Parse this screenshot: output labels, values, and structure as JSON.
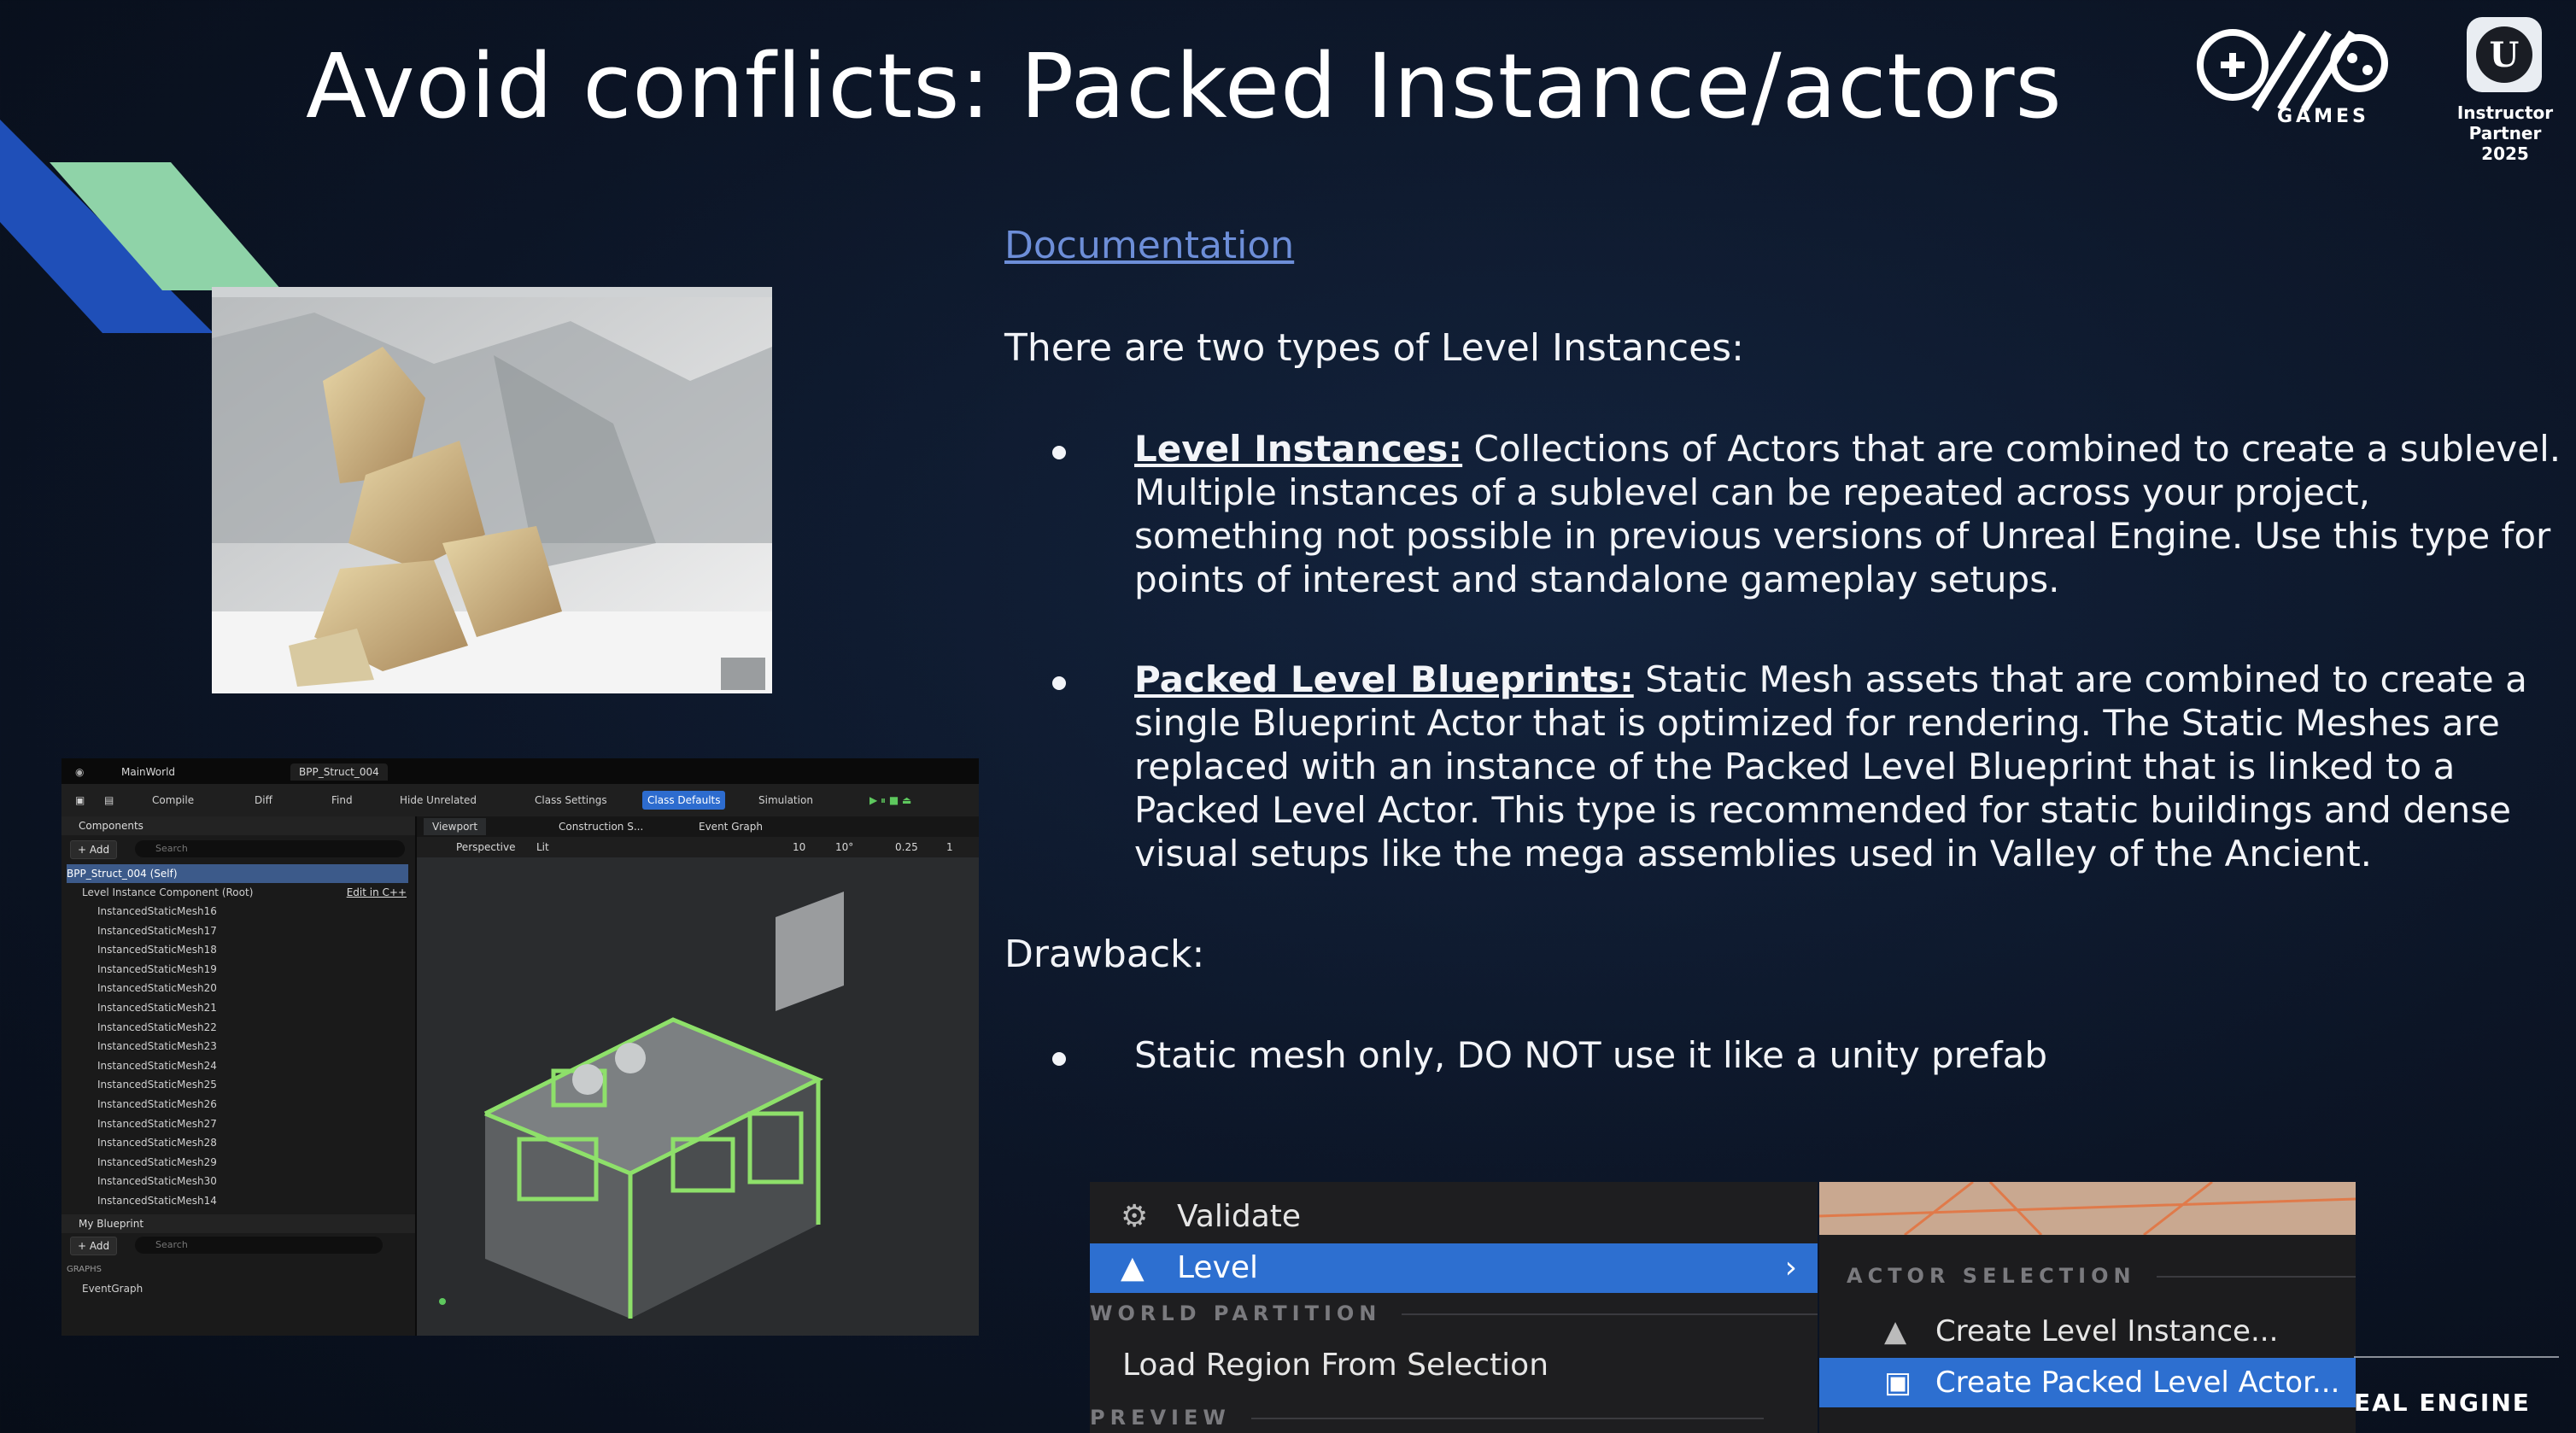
{
  "slide": {
    "title": "Avoid conflicts: Packed Instance/actors",
    "games_label": "GAMES",
    "partner": {
      "line1": "Instructor Partner",
      "line2": "2025"
    },
    "ue_badge_glyph": "U",
    "documentation_link": "Documentation",
    "intro": "There are two types of Level Instances:",
    "bullets": [
      {
        "term": "Level Instances:",
        "text": " Collections of Actors that are combined to create a sublevel.",
        "lines": [
          "Multiple instances of a sublevel can be repeated across your project,",
          "something not possible in previous versions of Unreal Engine. Use this type for",
          "points of interest and standalone gameplay setups."
        ]
      },
      {
        "term": "Packed Level Blueprints:",
        "text": " Static Mesh assets that are combined to create a",
        "lines": [
          "single Blueprint Actor that is optimized for rendering. The Static Meshes are",
          "replaced with an instance of the Packed Level Blueprint that is linked to a",
          "Packed Level Actor. This type is recommended for static buildings and dense",
          "visual setups like the mega assemblies used in Valley of the Ancient."
        ]
      }
    ],
    "drawback_heading": "Drawback:",
    "drawback_item": "Static mesh only, DO NOT use it like a unity prefab",
    "footer_brand": "EAL ENGINE"
  },
  "editor": {
    "tabs": [
      "MainWorld",
      "BPP_Struct_004"
    ],
    "toolbar": [
      "Compile",
      "Diff",
      "Find",
      "Hide Unrelated",
      "Class Settings",
      "Class Defaults",
      "Simulation"
    ],
    "components_title": "Components",
    "add_label": "+ Add",
    "search_placeholder": "Search",
    "root_item": "BPP_Struct_004 (Self)",
    "component_root": "Level Instance Component (Root)",
    "edit_in_cpp": "Edit in C++",
    "mesh_items": [
      "InstancedStaticMesh16",
      "InstancedStaticMesh17",
      "InstancedStaticMesh18",
      "InstancedStaticMesh19",
      "InstancedStaticMesh20",
      "InstancedStaticMesh21",
      "InstancedStaticMesh22",
      "InstancedStaticMesh23",
      "InstancedStaticMesh24",
      "InstancedStaticMesh25",
      "InstancedStaticMesh26",
      "InstancedStaticMesh27",
      "InstancedStaticMesh28",
      "InstancedStaticMesh29",
      "InstancedStaticMesh30",
      "InstancedStaticMesh14"
    ],
    "my_blueprint_title": "My Blueprint",
    "graphs_label": "GRAPHS",
    "event_graph_item": "EventGraph",
    "viewport_tabs": [
      "Viewport",
      "Construction S...",
      "Event Graph"
    ],
    "viewport_mode": "Perspective",
    "viewport_lit": "Lit",
    "viewport_snap": [
      "10",
      "10°",
      "0.25",
      "1"
    ]
  },
  "context_menu": {
    "items": {
      "validate": "Validate",
      "level": "Level",
      "world_partition": "WORLD PARTITION",
      "load_region": "Load Region From Selection",
      "preview": "PREVIEW"
    },
    "submenu": {
      "section": "ACTOR SELECTION",
      "create_level_instance": "Create Level Instance...",
      "create_packed": "Create Packed Level Actor..."
    },
    "highlight_color": "#2d6fd0"
  },
  "colors": {
    "background": "#0c1526",
    "link": "#6d8ed8",
    "stripe_blue": "#1f4fb8",
    "stripe_green": "#8fd3a8"
  }
}
